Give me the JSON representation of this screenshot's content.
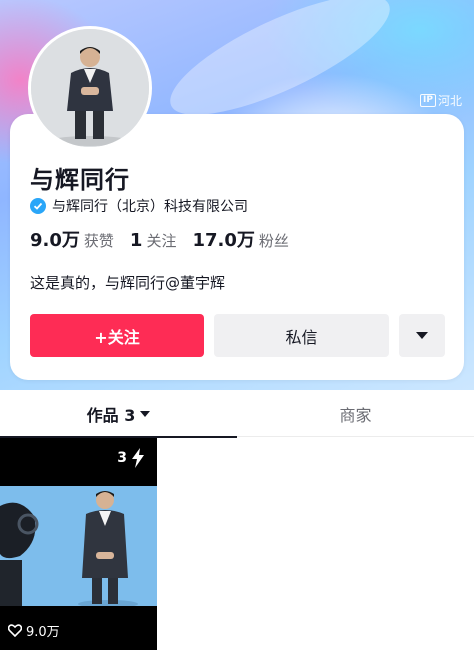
{
  "profile": {
    "name": "与辉同行",
    "verified_text": "与辉同行（北京）科技有限公司",
    "ip_location": "河北",
    "ip_badge": "IP",
    "bio": "这是真的，与辉同行@董宇辉",
    "stats": [
      {
        "value": "9.0万",
        "label": "获赞"
      },
      {
        "value": "1",
        "label": "关注"
      },
      {
        "value": "17.0万",
        "label": "粉丝"
      }
    ]
  },
  "actions": {
    "follow": "+关注",
    "message": "私信",
    "more_icon": "caret-down-icon"
  },
  "tabs": [
    {
      "label": "作品 3",
      "active": true
    },
    {
      "label": "商家",
      "active": false
    }
  ],
  "videos": [
    {
      "count": "3",
      "likes": "9.0万",
      "count_icon": "lightning-icon",
      "likes_icon": "heart-icon"
    }
  ],
  "colors": {
    "accent": "#fe2c55",
    "verified": "#2aa6f8",
    "text": "#161823",
    "muted": "#6b6c73"
  }
}
